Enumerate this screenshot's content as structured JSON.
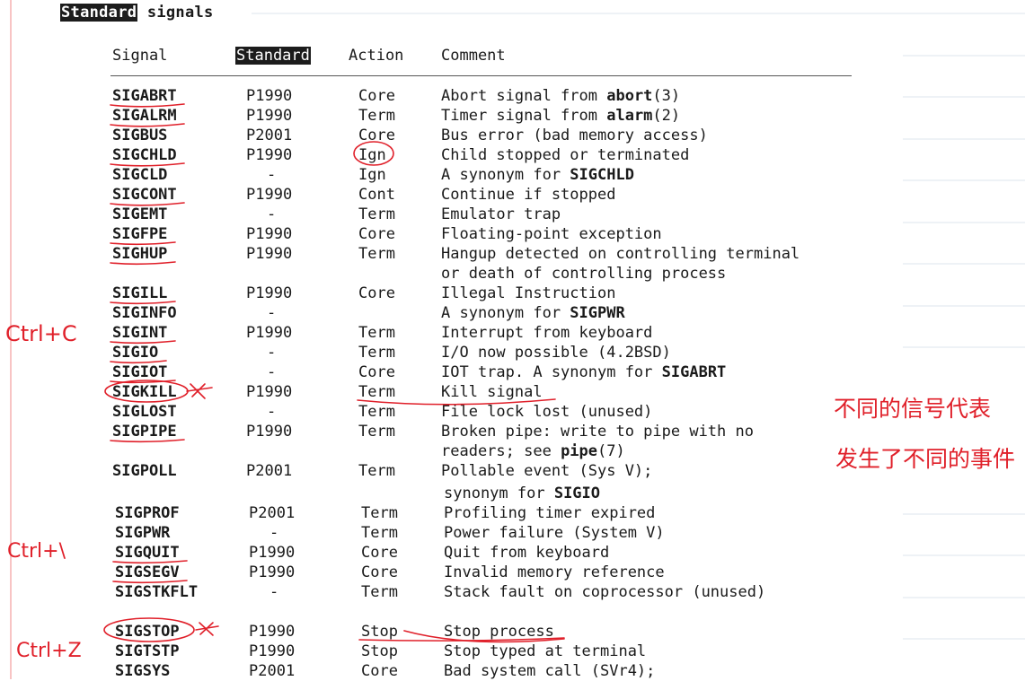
{
  "heading": {
    "highlight": "Standard",
    "rest": " signals"
  },
  "columns": {
    "signal": "Signal",
    "standard": "Standard",
    "action": "Action",
    "comment": "Comment"
  },
  "rows": [
    {
      "signal": "SIGABRT",
      "standard": "P1990",
      "action": "Core",
      "comment": [
        {
          "t": "Abort signal from "
        },
        {
          "t": "abort",
          "b": true
        },
        {
          "t": "(3)"
        }
      ]
    },
    {
      "signal": "SIGALRM",
      "standard": "P1990",
      "action": "Term",
      "comment": [
        {
          "t": "Timer signal from "
        },
        {
          "t": "alarm",
          "b": true
        },
        {
          "t": "(2)"
        }
      ]
    },
    {
      "signal": "SIGBUS",
      "standard": "P2001",
      "action": "Core",
      "comment": [
        {
          "t": "Bus error (bad memory access)"
        }
      ]
    },
    {
      "signal": "SIGCHLD",
      "standard": "P1990",
      "action": "Ign",
      "comment": [
        {
          "t": "Child stopped or terminated"
        }
      ]
    },
    {
      "signal": "SIGCLD",
      "standard": "-",
      "action": "Ign",
      "comment": [
        {
          "t": "A synonym for "
        },
        {
          "t": "SIGCHLD",
          "b": true
        }
      ]
    },
    {
      "signal": "SIGCONT",
      "standard": "P1990",
      "action": "Cont",
      "comment": [
        {
          "t": "Continue if stopped"
        }
      ]
    },
    {
      "signal": "SIGEMT",
      "standard": "-",
      "action": "Term",
      "comment": [
        {
          "t": "Emulator trap"
        }
      ]
    },
    {
      "signal": "SIGFPE",
      "standard": "P1990",
      "action": "Core",
      "comment": [
        {
          "t": "Floating-point exception"
        }
      ]
    },
    {
      "signal": "SIGHUP",
      "standard": "P1990",
      "action": "Term",
      "comment": [
        {
          "t": "Hangup detected on controlling terminal"
        }
      ]
    },
    {
      "signal": "",
      "standard": "",
      "action": "",
      "comment": [
        {
          "t": "or death of controlling process"
        }
      ]
    },
    {
      "signal": "SIGILL",
      "standard": "P1990",
      "action": "Core",
      "comment": [
        {
          "t": "Illegal Instruction"
        }
      ]
    },
    {
      "signal": "SIGINFO",
      "standard": "-",
      "action": "",
      "comment": [
        {
          "t": "A synonym for "
        },
        {
          "t": "SIGPWR",
          "b": true
        }
      ]
    },
    {
      "signal": "SIGINT",
      "standard": "P1990",
      "action": "Term",
      "comment": [
        {
          "t": "Interrupt from keyboard"
        }
      ]
    },
    {
      "signal": "SIGIO",
      "standard": "-",
      "action": "Term",
      "comment": [
        {
          "t": "I/O now possible (4.2BSD)"
        }
      ]
    },
    {
      "signal": "SIGIOT",
      "standard": "-",
      "action": "Core",
      "comment": [
        {
          "t": "IOT trap. A synonym for "
        },
        {
          "t": "SIGABRT",
          "b": true
        }
      ]
    },
    {
      "signal": "SIGKILL",
      "standard": "P1990",
      "action": "Term",
      "comment": [
        {
          "t": "Kill signal"
        }
      ]
    },
    {
      "signal": "SIGLOST",
      "standard": "-",
      "action": "Term",
      "comment": [
        {
          "t": "File lock lost (unused)"
        }
      ]
    },
    {
      "signal": "SIGPIPE",
      "standard": "P1990",
      "action": "Term",
      "comment": [
        {
          "t": "Broken pipe: write to pipe with no"
        }
      ]
    },
    {
      "signal": "",
      "standard": "",
      "action": "",
      "comment": [
        {
          "t": "readers; see "
        },
        {
          "t": "pipe",
          "b": true
        },
        {
          "t": "(7)"
        }
      ]
    },
    {
      "signal": "SIGPOLL",
      "standard": "P2001",
      "action": "Term",
      "comment": [
        {
          "t": "Pollable event (Sys V);"
        }
      ]
    },
    {
      "signal": "",
      "standard": "",
      "action": "",
      "comment": [
        {
          "t": "synonym for "
        },
        {
          "t": "SIGIO",
          "b": true
        }
      ]
    },
    {
      "signal": "SIGPROF",
      "standard": "P2001",
      "action": "Term",
      "comment": [
        {
          "t": "Profiling timer expired"
        }
      ]
    },
    {
      "signal": "SIGPWR",
      "standard": "-",
      "action": "Term",
      "comment": [
        {
          "t": "Power failure (System V)"
        }
      ]
    },
    {
      "signal": "SIGQUIT",
      "standard": "P1990",
      "action": "Core",
      "comment": [
        {
          "t": "Quit from keyboard"
        }
      ]
    },
    {
      "signal": "SIGSEGV",
      "standard": "P1990",
      "action": "Core",
      "comment": [
        {
          "t": "Invalid memory reference"
        }
      ]
    },
    {
      "signal": "SIGSTKFLT",
      "standard": "-",
      "action": "Term",
      "comment": [
        {
          "t": "Stack fault on coprocessor (unused)"
        }
      ]
    },
    {
      "signal": "SIGSTOP",
      "standard": "P1990",
      "action": "Stop",
      "comment": [
        {
          "t": "Stop process"
        }
      ]
    },
    {
      "signal": "SIGTSTP",
      "standard": "P1990",
      "action": "Stop",
      "comment": [
        {
          "t": "Stop typed at terminal"
        }
      ]
    },
    {
      "signal": "SIGSYS",
      "standard": "P2001",
      "action": "Core",
      "comment": [
        {
          "t": "Bad system call (SVr4);"
        }
      ]
    }
  ],
  "annotations": {
    "ctrl_c": "Ctrl+C",
    "ctrl_backslash": "Ctrl+\\",
    "ctrl_z": "Ctrl+Z",
    "note_line1": "不同的信号代表",
    "note_line2": "发生了不同的事件"
  },
  "colors": {
    "ink": "#e0202a",
    "highlight_bg": "#1c1c1c",
    "rule_line": "#d8e4ec"
  }
}
